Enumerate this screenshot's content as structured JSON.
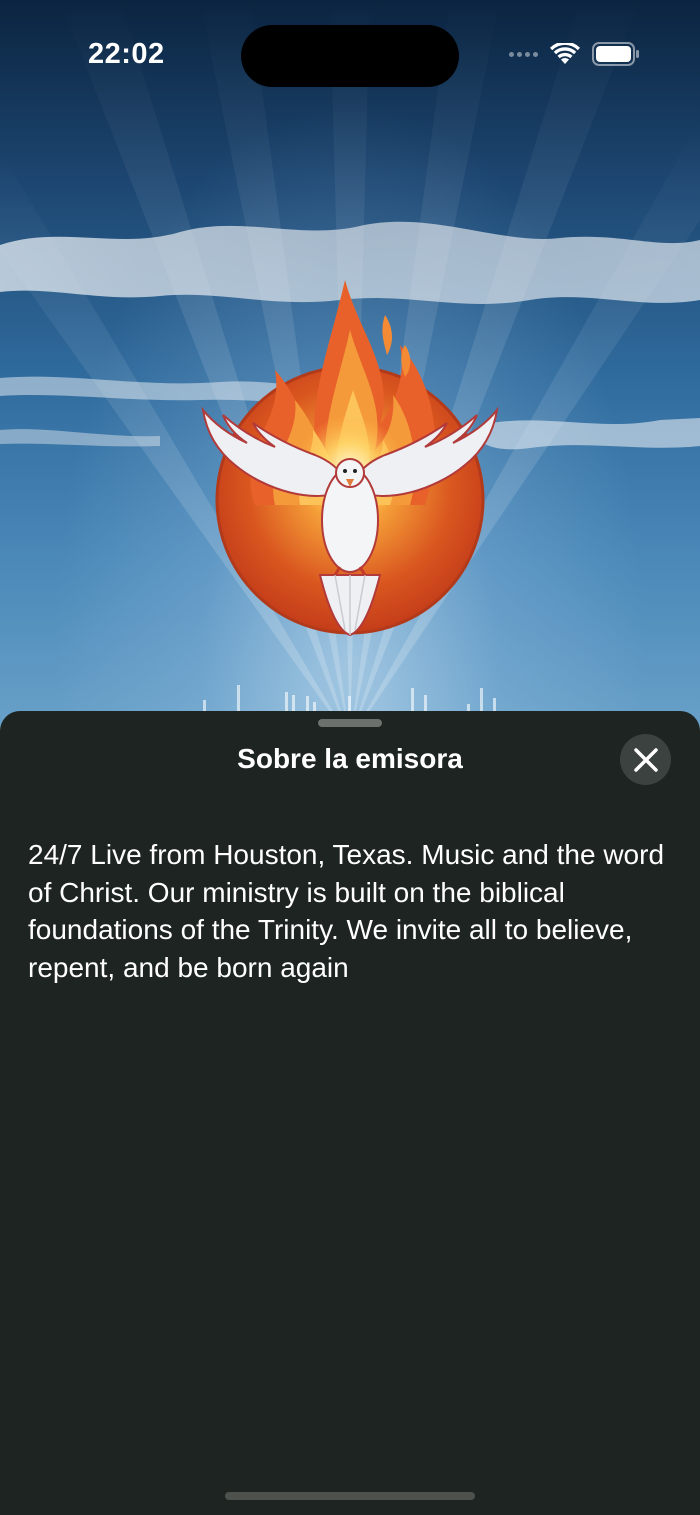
{
  "status_bar": {
    "time": "22:02",
    "icons": [
      "signal-dots-icon",
      "wifi-icon",
      "battery-icon"
    ]
  },
  "hero": {
    "logo": "flaming-dove-logo-icon",
    "visualizer": "audio-equalizer-icon"
  },
  "sheet": {
    "title": "Sobre la emisora",
    "close_icon": "close-icon",
    "description": "24/7 Live from Houston, Texas. Music and the word of Christ. Our ministry is built on the biblical foundations of the Trinity. We invite all to believe, repent, and be born again"
  },
  "colors": {
    "sheet_background": "#1e2421",
    "close_button_background": "#3c423f",
    "text": "#ffffff",
    "sky_top": "#0b2440",
    "sky_bottom": "#6aa2c9"
  }
}
